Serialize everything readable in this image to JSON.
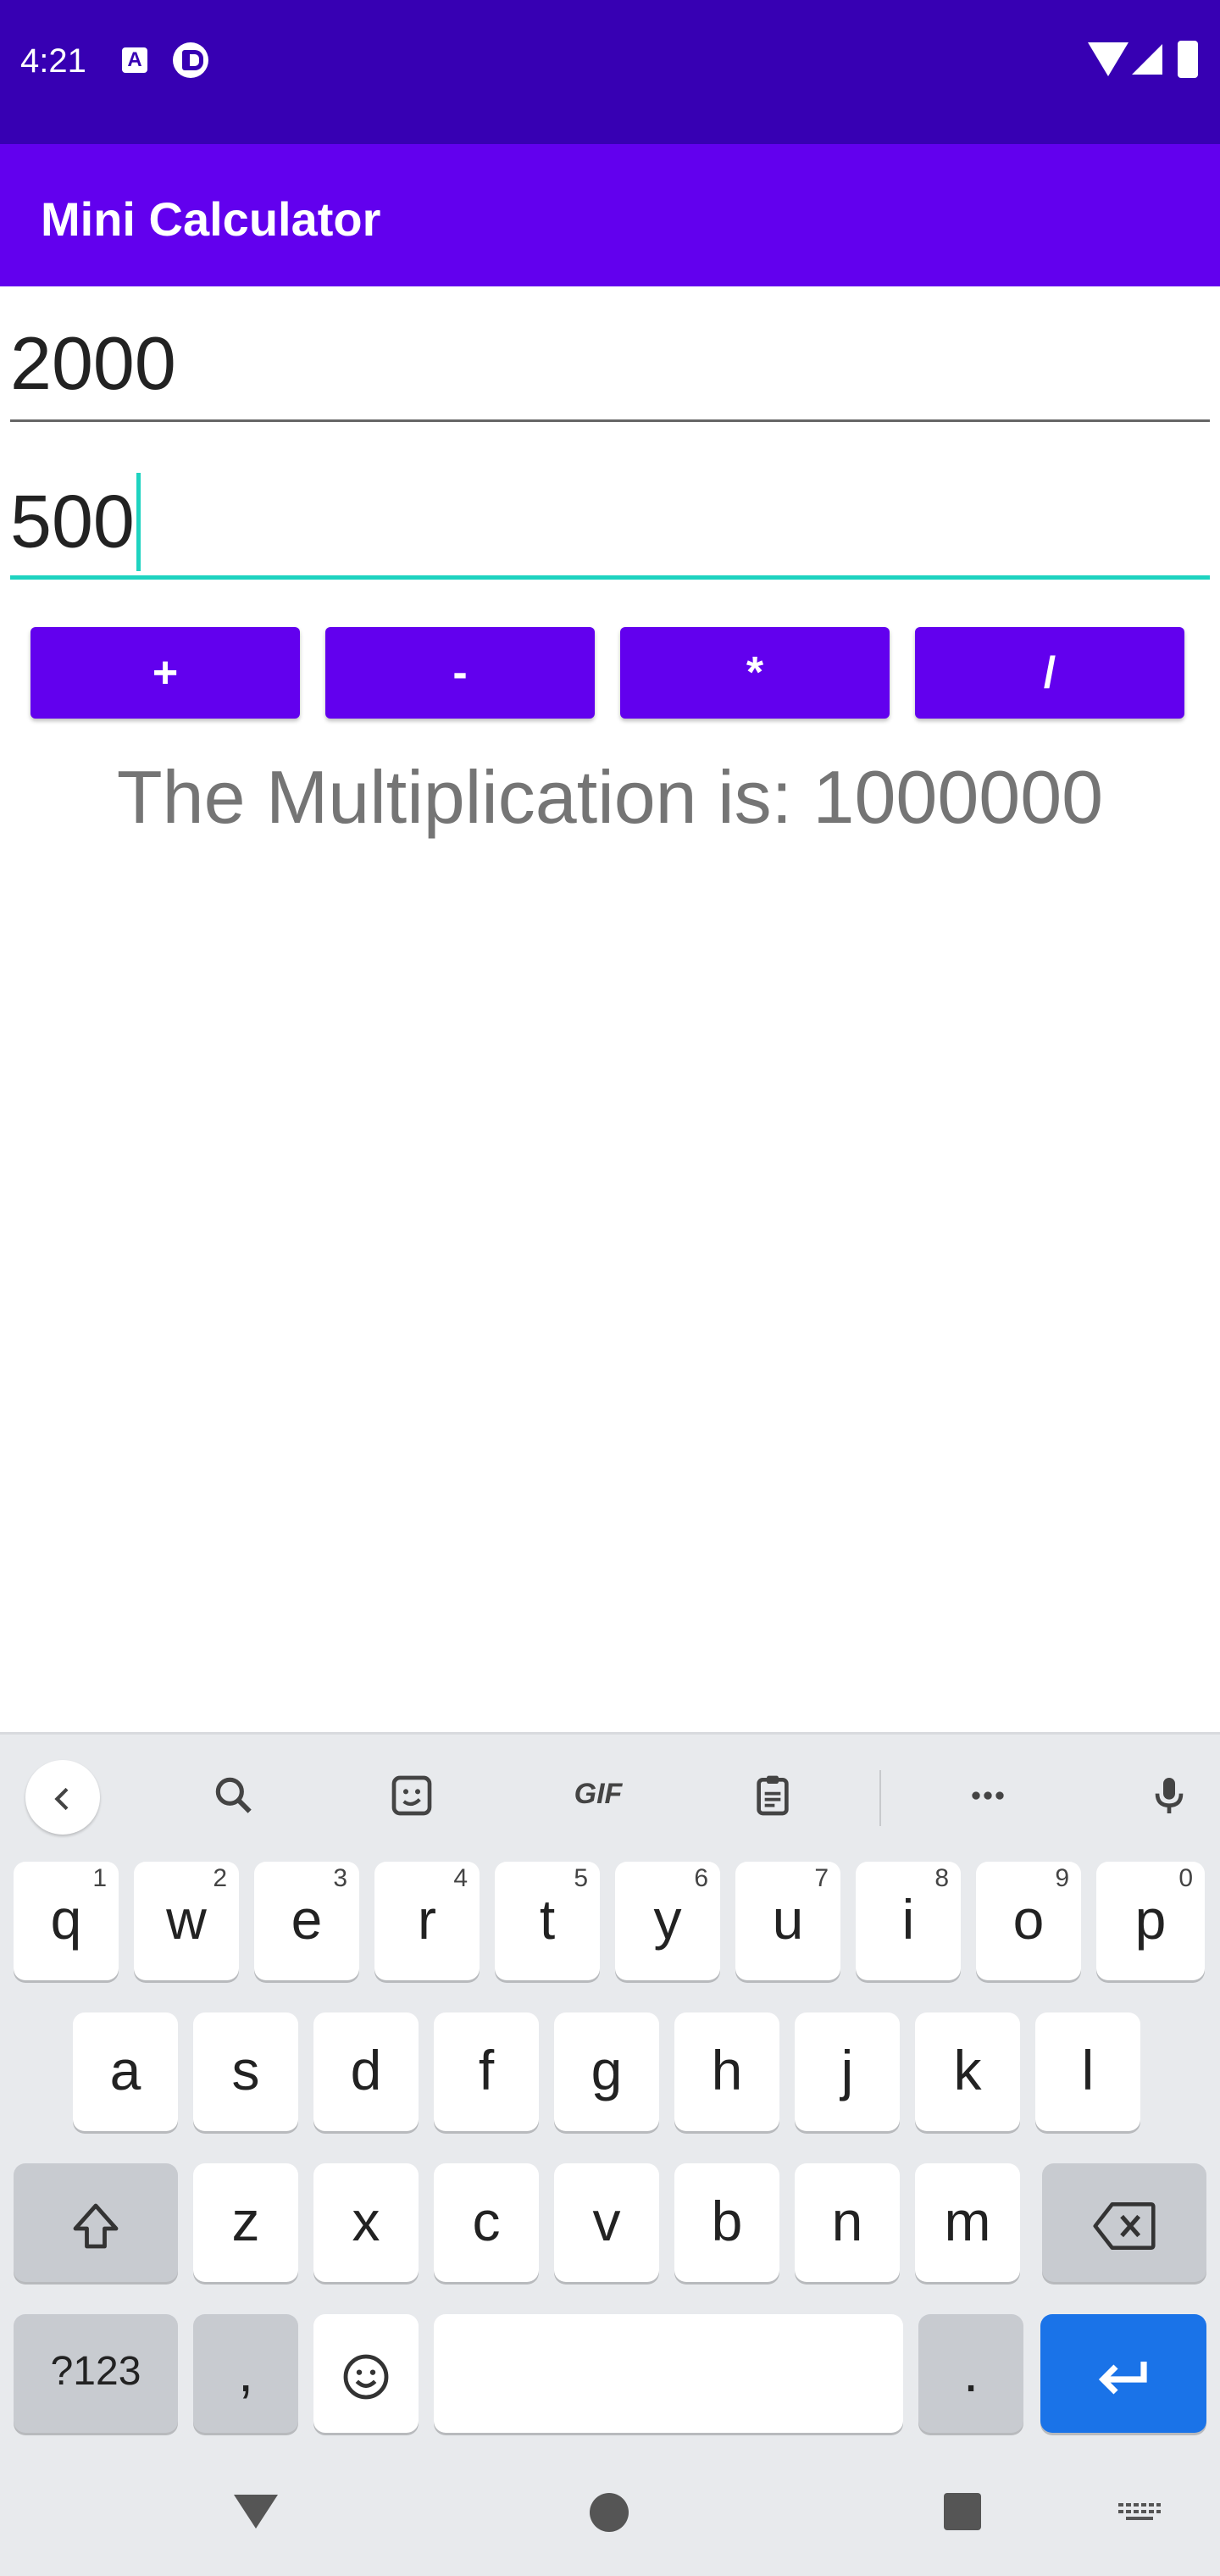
{
  "status_bar": {
    "time": "4:21",
    "icon_a": "A"
  },
  "app_bar": {
    "title": "Mini Calculator"
  },
  "inputs": {
    "first_value": "2000",
    "second_value": "500"
  },
  "operations": {
    "add": "+",
    "subtract": "-",
    "multiply": "*",
    "divide": "/"
  },
  "result": {
    "text": "The Multiplication is: 1000000"
  },
  "keyboard": {
    "toolbar": {
      "gif": "GIF"
    },
    "row1": [
      {
        "key": "q",
        "hint": "1"
      },
      {
        "key": "w",
        "hint": "2"
      },
      {
        "key": "e",
        "hint": "3"
      },
      {
        "key": "r",
        "hint": "4"
      },
      {
        "key": "t",
        "hint": "5"
      },
      {
        "key": "y",
        "hint": "6"
      },
      {
        "key": "u",
        "hint": "7"
      },
      {
        "key": "i",
        "hint": "8"
      },
      {
        "key": "o",
        "hint": "9"
      },
      {
        "key": "p",
        "hint": "0"
      }
    ],
    "row2": [
      "a",
      "s",
      "d",
      "f",
      "g",
      "h",
      "j",
      "k",
      "l"
    ],
    "row3": [
      "z",
      "x",
      "c",
      "v",
      "b",
      "n",
      "m"
    ],
    "row4": {
      "symbols": "?123",
      "comma": ",",
      "period": "."
    }
  }
}
